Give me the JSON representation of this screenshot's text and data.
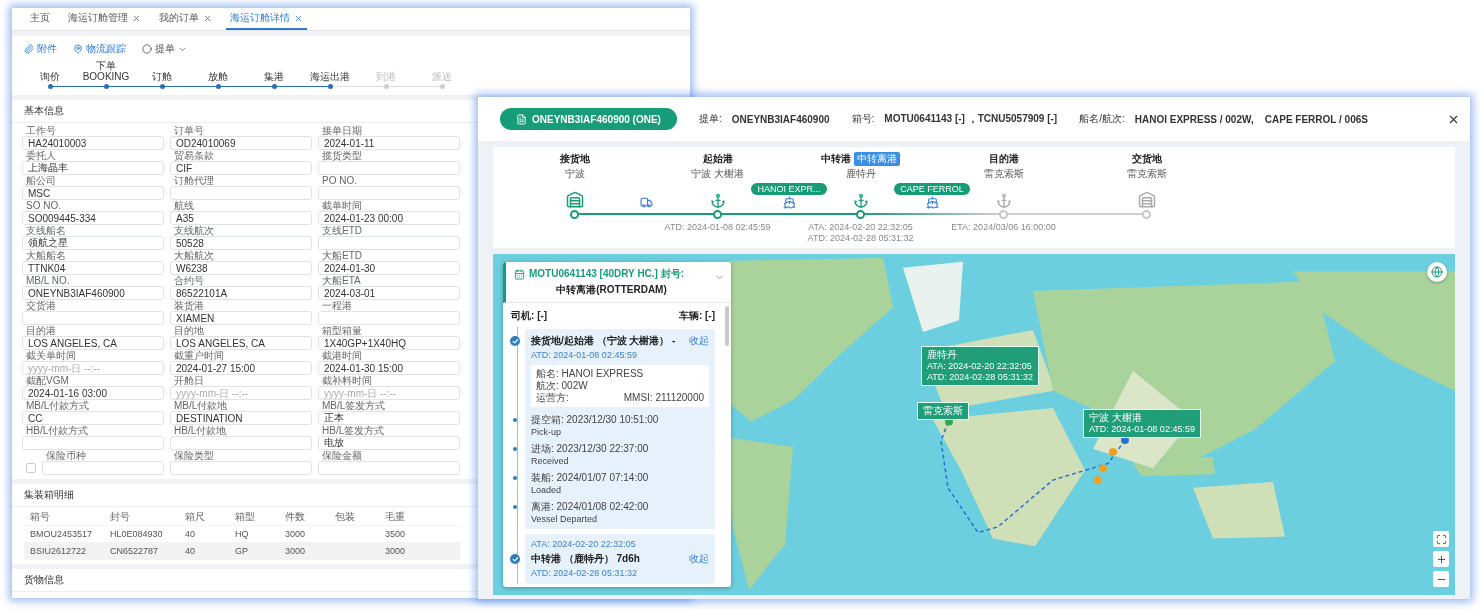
{
  "left_window": {
    "tabs": [
      {
        "label": "主页",
        "closable": false,
        "selected": false
      },
      {
        "label": "海运订舱管理",
        "closable": true,
        "selected": false
      },
      {
        "label": "我的订单",
        "closable": true,
        "selected": false
      },
      {
        "label": "海运订舱详情",
        "closable": true,
        "selected": true
      }
    ],
    "toolbar": [
      {
        "label": "附件",
        "kind": "button"
      },
      {
        "label": "物流跟踪",
        "kind": "button"
      },
      {
        "label": "提单",
        "kind": "dropdown"
      }
    ],
    "steps": [
      {
        "label": "询价",
        "done": true
      },
      {
        "label": "下单 BOOKING",
        "done": true
      },
      {
        "label": "订舱",
        "done": true
      },
      {
        "label": "放舱",
        "done": true
      },
      {
        "label": "集港",
        "done": true
      },
      {
        "label": "海运出港",
        "done": true
      },
      {
        "label": "到港",
        "done": false
      },
      {
        "label": "派送",
        "done": false
      }
    ],
    "basic_info": {
      "title": "基本信息",
      "fields": [
        {
          "label": "工作号",
          "value": "HA24010003"
        },
        {
          "label": "订单号",
          "value": "OD24010069"
        },
        {
          "label": "接单日期",
          "value": "2024-01-11"
        },
        {
          "label": "委托人",
          "value": "上海晶丰"
        },
        {
          "label": "贸易条款",
          "value": "CIF"
        },
        {
          "label": "揽货类型"
        },
        {
          "label": "船公司",
          "value": "MSC"
        },
        {
          "label": "订舱代理"
        },
        {
          "label": "PO NO."
        },
        {
          "label": "SO NO.",
          "value": "SO009445-334"
        },
        {
          "label": "航线",
          "value": "A35"
        },
        {
          "label": "截单时间",
          "value": "2024-01-23 00:00"
        },
        {
          "label": "支线船名",
          "value": "领航之星"
        },
        {
          "label": "支线航次",
          "value": "50528"
        },
        {
          "label": "支线ETD"
        },
        {
          "label": "大船船名",
          "value": "TTNK04"
        },
        {
          "label": "大船航次",
          "value": "W6238"
        },
        {
          "label": "大船ETD",
          "value": "2024-01-30"
        },
        {
          "label": "MB/L NO.",
          "value": "ONEYNB3IAF460900"
        },
        {
          "label": "合约号",
          "value": "86522101A"
        },
        {
          "label": "大船ETA",
          "value": "2024-03-01"
        },
        {
          "label": "交货港"
        },
        {
          "label": "装货港",
          "value": "XIAMEN"
        },
        {
          "label": "一程港"
        },
        {
          "label": "目的港",
          "value": "LOS ANGELES, CA"
        },
        {
          "label": "目的地",
          "value": "LOS ANGELES, CA"
        },
        {
          "label": "箱型箱量",
          "value": "1X40GP+1X40HQ"
        },
        {
          "label": "截关单时间",
          "placeholder": "yyyy-mm-日 --:--"
        },
        {
          "label": "截重户时间",
          "value": "2024-01-27 15:00"
        },
        {
          "label": "截港时间",
          "value": "2024-01-30 15:00"
        },
        {
          "label": "截配VGM",
          "value": "2024-01-16 03:00"
        },
        {
          "label": "开舱日",
          "placeholder": "yyyy-mm-日 --:--"
        },
        {
          "label": "截补料时间",
          "placeholder": "yyyy-mm-日 --:--"
        },
        {
          "label": "MB/L付款方式",
          "value": "CC"
        },
        {
          "label": "MB/L付款地",
          "value": "DESTINATION"
        },
        {
          "label": "MB/L签发方式",
          "value": "正本"
        },
        {
          "label": "HB/L付款方式"
        },
        {
          "label": "HB/L付款地"
        },
        {
          "label": "HB/L签发方式",
          "value": "电放"
        },
        {
          "label": "保险币种",
          "kind": "checkbox",
          "checked": false
        },
        {
          "label": "保险类型"
        },
        {
          "label": "保险金额"
        }
      ]
    },
    "containers": {
      "title": "集装箱明细",
      "columns": [
        "箱号",
        "封号",
        "箱尺",
        "箱型",
        "件数",
        "包装",
        "毛重"
      ],
      "rows": [
        {
          "cells": [
            "BMOU2453517",
            "HL0E084930",
            "40",
            "HQ",
            "3000",
            "",
            "3500"
          ],
          "selected": false
        },
        {
          "cells": [
            "BSIU2612722",
            "CN6522787",
            "40",
            "GP",
            "3000",
            "",
            "3000"
          ],
          "selected": true
        }
      ]
    },
    "cargo": {
      "title": "货物信息"
    }
  },
  "tracking_window": {
    "bl_badge": "ONEYNB3IAF460900 (ONE)",
    "info": [
      {
        "label": "提单:",
        "value": "ONEYNB3IAF460900"
      },
      {
        "label": "箱号:",
        "value": "MOTU0641143 [-] ，TCNU5057909 [-]"
      },
      {
        "label": "船名/航次:",
        "value": "HANOI EXPRESS / 002W,    CAPE FERROL / 006S"
      }
    ],
    "stops": [
      {
        "title": "接货地",
        "place": "宁波",
        "kind": "warehouse",
        "reached": true
      },
      {
        "title": "起始港",
        "place": "宁波 大榭港",
        "kind": "port",
        "reached": true,
        "dates": [
          "ATD:  2024-01-08 02:45:59"
        ]
      },
      {
        "title": "中转港",
        "badge": "中转离港",
        "place": "鹿特丹",
        "kind": "port",
        "reached": true,
        "dates": [
          "ATA:  2024-02-20 22:32:05",
          "ATD:  2024-02-28 05:31:32"
        ]
      },
      {
        "title": "目的港",
        "place": "雷克索斯",
        "kind": "port",
        "reached": false,
        "dates": [
          "ETA:  2024/03/06 16:00:00"
        ]
      },
      {
        "title": "交货地",
        "place": "雷克索斯",
        "kind": "warehouse",
        "reached": false
      }
    ],
    "legs": [
      {
        "kind": "truck"
      },
      {
        "kind": "ship",
        "label": "HANOI EXPR..."
      },
      {
        "kind": "ship",
        "label": "CAPE FERROL"
      },
      {
        "kind": "none"
      }
    ],
    "map": {
      "panel": {
        "container": "MOTU0641143 [40DRY HC.] 封号:",
        "status": "中转离港(ROTTERDAM)",
        "driver_label": "司机:",
        "driver": "[-]",
        "vehicle_label": "车辆:",
        "vehicle": "[-]",
        "stages": [
          {
            "title": "接货地/起始港 （宁波 大榭港） -",
            "toggle": "收起",
            "completed": true,
            "after": "ATD:  2024-01-08 02:45:59",
            "vessel": {
              "lines": [
                "船名: HANOI EXPRESS",
                "航次: 002W"
              ],
              "operator": "运营方:",
              "mmsi": "MMSI: 211120000"
            },
            "events": [
              {
                "label": "提空箱: 2023/12/30 10:51:00",
                "status": "Pick-up"
              },
              {
                "label": "进场: 2023/12/30 22:37:00",
                "status": "Received"
              },
              {
                "label": "装船: 2024/01/07 07:14:00",
                "status": "Loaded"
              },
              {
                "label": "离港: 2024/01/08 02:42:00",
                "status": "Vessel Departed"
              }
            ]
          },
          {
            "before": "ATA:  2024-02-20 22:32:05",
            "title": "中转港 （鹿特丹） 7d6h",
            "toggle": "收起",
            "completed": true,
            "after": "ATD:  2024-02-28 05:31:32"
          }
        ]
      },
      "popups": [
        {
          "title": "鹿特丹",
          "lines": [
            "ATA:  2024-02-20 22:32:05",
            "ATD:  2024-02-28 05:31:32"
          ]
        },
        {
          "title": "宁波 大榭港",
          "lines": [
            "ATD:  2024-01-08 02:45:59"
          ]
        },
        {
          "title": "雷克索斯"
        }
      ]
    }
  }
}
